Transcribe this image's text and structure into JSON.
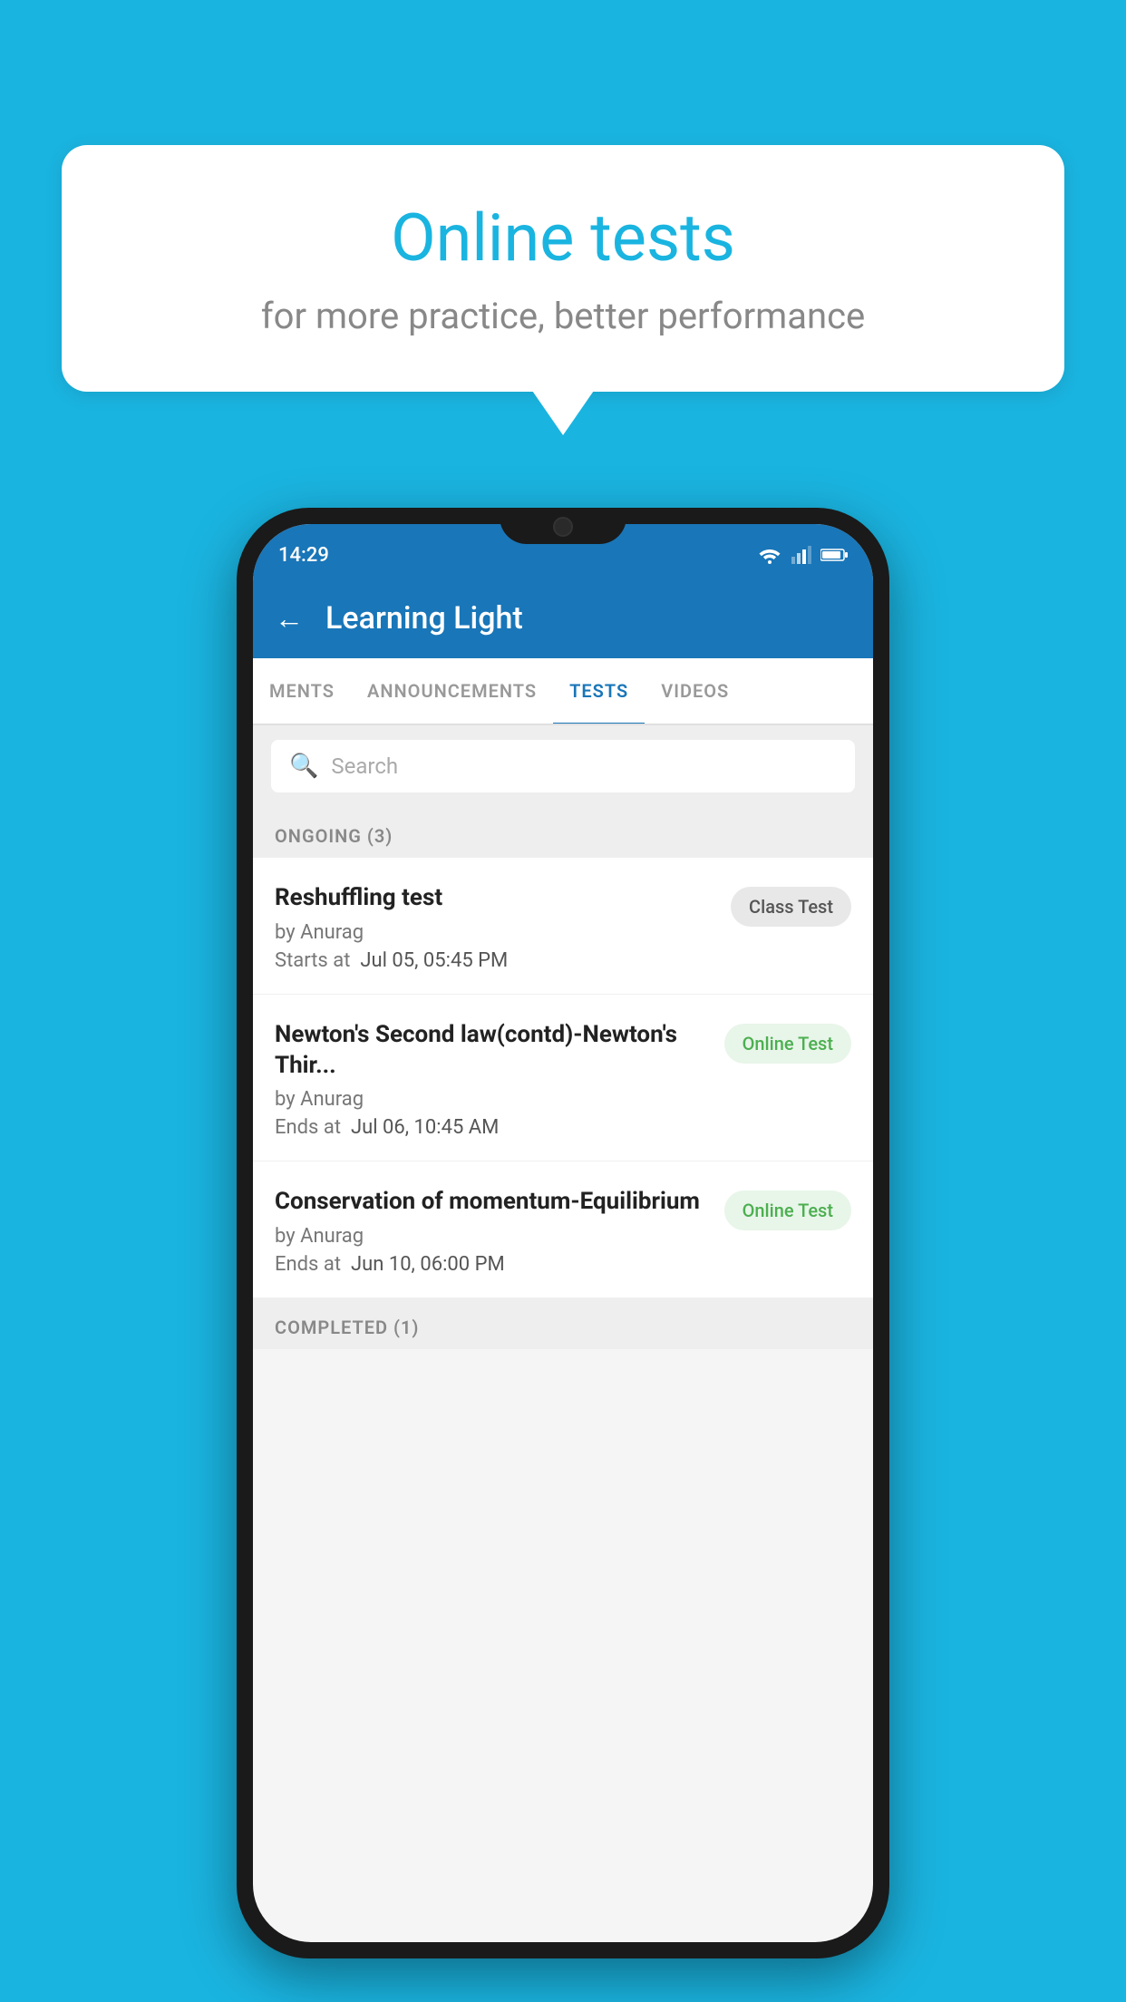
{
  "background_color": "#1ab4e0",
  "bubble": {
    "title": "Online tests",
    "subtitle": "for more practice, better performance"
  },
  "phone": {
    "status_bar": {
      "time": "14:29"
    },
    "app_bar": {
      "title": "Learning Light",
      "back_label": "←"
    },
    "tabs": [
      {
        "label": "MENTS",
        "active": false
      },
      {
        "label": "ANNOUNCEMENTS",
        "active": false
      },
      {
        "label": "TESTS",
        "active": true
      },
      {
        "label": "VIDEOS",
        "active": false
      }
    ],
    "search": {
      "placeholder": "Search"
    },
    "sections": {
      "ongoing": {
        "title": "ONGOING (3)",
        "tests": [
          {
            "name": "Reshuffling test",
            "author": "by Anurag",
            "time_label": "Starts at",
            "time_value": "Jul 05, 05:45 PM",
            "badge": "Class Test",
            "badge_type": "class"
          },
          {
            "name": "Newton's Second law(contd)-Newton's Thir...",
            "author": "by Anurag",
            "time_label": "Ends at",
            "time_value": "Jul 06, 10:45 AM",
            "badge": "Online Test",
            "badge_type": "online"
          },
          {
            "name": "Conservation of momentum-Equilibrium",
            "author": "by Anurag",
            "time_label": "Ends at",
            "time_value": "Jun 10, 06:00 PM",
            "badge": "Online Test",
            "badge_type": "online"
          }
        ]
      },
      "completed": {
        "title": "COMPLETED (1)"
      }
    }
  }
}
